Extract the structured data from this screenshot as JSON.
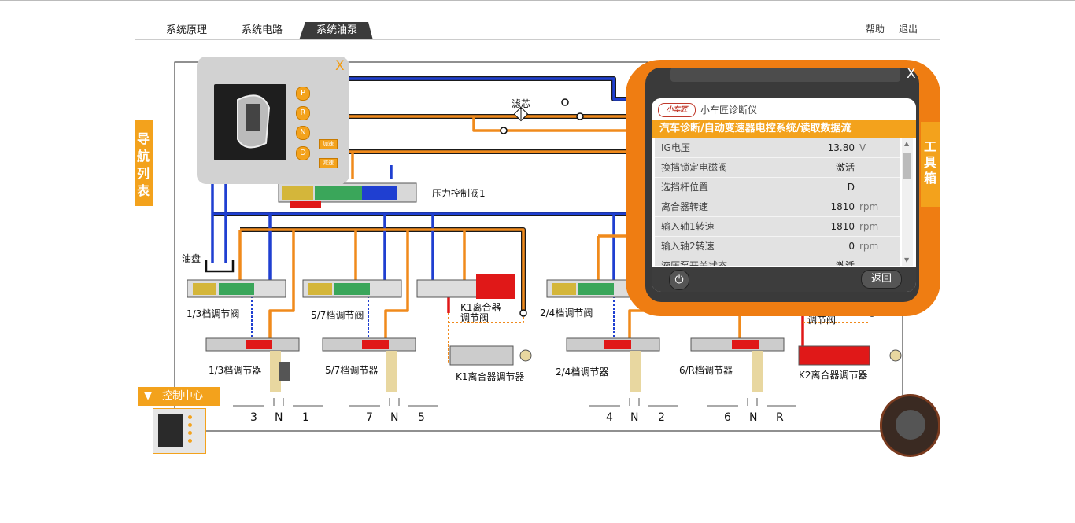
{
  "tabs": [
    "系统原理",
    "系统电路",
    "系统油泵"
  ],
  "active_tab": 2,
  "top_links": {
    "help": "帮助",
    "exit": "退出"
  },
  "nav_tab_label": "导航列表",
  "tools_tab_label": "工具箱",
  "control_center_label": "控制中心",
  "gear_popup": {
    "close": "X",
    "gears": [
      "P",
      "R",
      "N",
      "D"
    ],
    "buttons": [
      "加速",
      "减速"
    ]
  },
  "diagram": {
    "filter": "滤芯",
    "pressure_valve": "压力控制阀1",
    "oil_pan": "油盘",
    "valves": [
      {
        "valve": "1/3档调节阀",
        "regulator": "1/3档调节器",
        "positions": [
          "3",
          "N",
          "1"
        ]
      },
      {
        "valve": "5/7档调节阀",
        "regulator": "5/7档调节器",
        "positions": [
          "7",
          "N",
          "5"
        ]
      },
      {
        "valve": "2/4档调节阀",
        "regulator": "2/4档调节器",
        "positions": [
          "4",
          "N",
          "2"
        ]
      },
      {
        "valve": "调节阀",
        "regulator": "6/R档调节器",
        "positions": [
          "6",
          "N",
          "R"
        ]
      }
    ],
    "k1_valve": "K1离合器\n调节阀",
    "k1_regulator": "K1离合器调节器",
    "k2_valve": "调节阀",
    "k2_regulator": "K2离合器调节器"
  },
  "device": {
    "close": "X",
    "brand_logo": "小车匠",
    "brand_name": "小车匠诊断仪",
    "breadcrumb": "汽车诊断/自动变速器电控系统/读取数据流",
    "rows": [
      {
        "name": "IG电压",
        "value": "13.80",
        "unit": "V"
      },
      {
        "name": "换挡锁定电磁阀",
        "value": "激活",
        "unit": ""
      },
      {
        "name": "选挡杆位置",
        "value": "D",
        "unit": ""
      },
      {
        "name": "离合器转速",
        "value": "1810",
        "unit": "rpm"
      },
      {
        "name": "输入轴1转速",
        "value": "1810",
        "unit": "rpm"
      },
      {
        "name": "输入轴2转速",
        "value": "0",
        "unit": "rpm"
      },
      {
        "name": "液压泵开关状态",
        "value": "激活",
        "unit": ""
      }
    ],
    "back_button": "返回"
  },
  "colors": {
    "accent": "#f3a21c",
    "pipe_orange": "#f08a1c",
    "pipe_blue": "#1f3fd1",
    "pipe_red": "#e01818"
  }
}
